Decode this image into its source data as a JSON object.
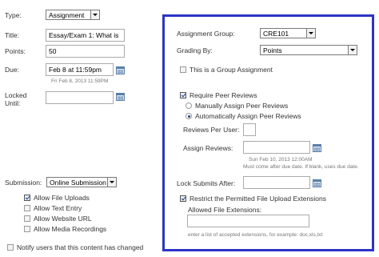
{
  "left": {
    "type_label": "Type:",
    "type_value": "Assignment",
    "title_label": "Title:",
    "title_value": "Essay/Exam 1: What is",
    "points_label": "Points:",
    "points_value": "50",
    "due_label": "Due:",
    "due_value": "Feb 8 at 11:59pm",
    "due_hint": "Fri Feb 8, 2013 11:59PM",
    "locked_label_1": "Locked",
    "locked_label_2": "Until:",
    "locked_value": "",
    "submission_label": "Submission:",
    "submission_value": "Online Submission",
    "submission_options": [
      {
        "label": "Allow File Uploads",
        "checked": true
      },
      {
        "label": "Allow Text Entry",
        "checked": false
      },
      {
        "label": "Allow Website URL",
        "checked": false
      },
      {
        "label": "Allow Media Recordings",
        "checked": false
      }
    ],
    "notify_label": "Notify users that this content has changed",
    "notify_checked": false
  },
  "panel": {
    "border_color": "#2d33c8",
    "assignment_group_label": "Assignment Group:",
    "assignment_group_value": "CRE101",
    "grading_by_label": "Grading By:",
    "grading_by_value": "Points",
    "group_assignment_label": "This is a Group Assignment",
    "group_assignment_checked": false,
    "peer_reviews_label": "Require Peer Reviews",
    "peer_reviews_checked": true,
    "manual_label": "Manually Assign Peer Reviews",
    "manual_checked": false,
    "auto_label": "Automatically Assign Peer Reviews",
    "auto_checked": true,
    "reviews_per_user_label": "Reviews Per User:",
    "reviews_per_user_value": "",
    "assign_reviews_label": "Assign Reviews:",
    "assign_reviews_value": "",
    "assign_reviews_hint": "Sun Feb 10, 2013 12:00AM",
    "assign_reviews_note": "Must come after due date. If blank, uses due date.",
    "lock_submits_label": "Lock Submits After:",
    "lock_submits_value": "",
    "restrict_label": "Restrict the Permitted File Upload Extensions",
    "restrict_checked": true,
    "allowed_ext_label": "Allowed File Extensions:",
    "allowed_ext_value": "",
    "allowed_ext_hint": "enter a list of accepted extensions, for example: doc,xls,txt"
  }
}
